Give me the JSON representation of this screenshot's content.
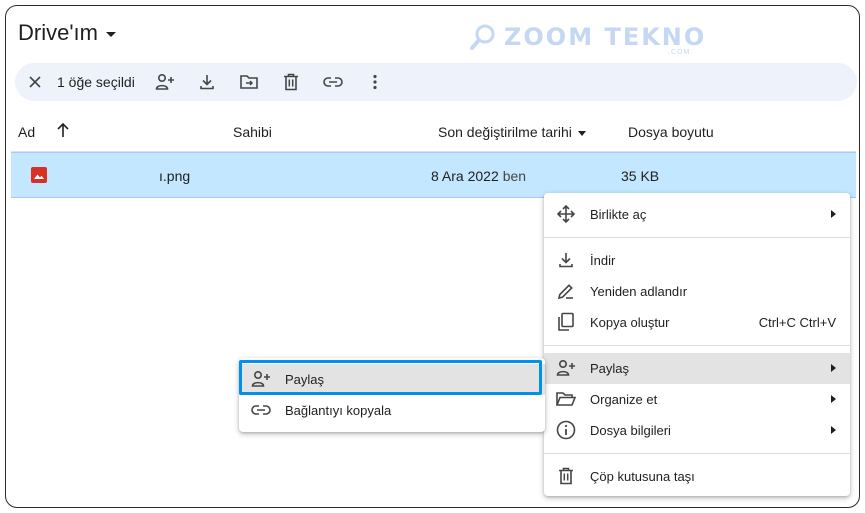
{
  "header": {
    "title": "Drive'ım"
  },
  "watermark": {
    "text": "ZOOM TEKNO",
    "sub": ".COM"
  },
  "selection_bar": {
    "count_label": "1 öğe seçildi"
  },
  "columns": {
    "name": "Ad",
    "owner": "Sahibi",
    "modified": "Son değiştirilme tarihi",
    "size": "Dosya boyutu"
  },
  "file_row": {
    "name": "ı.png",
    "modified": "8 Ara 2022",
    "modified_by": "ben",
    "size": "35 KB"
  },
  "context_menu": {
    "open_with": "Birlikte aç",
    "download": "İndir",
    "rename": "Yeniden adlandır",
    "copy": "Kopya oluştur",
    "copy_shortcut": "Ctrl+C Ctrl+V",
    "share": "Paylaş",
    "organize": "Organize et",
    "file_info": "Dosya bilgileri",
    "trash": "Çöp kutusuna taşı"
  },
  "share_submenu": {
    "share": "Paylaş",
    "copy_link": "Bağlantıyı kopyala"
  },
  "colors": {
    "selected_row": "#c2e7ff",
    "selection_bar": "#edf2fb",
    "focus": "#0091ea",
    "image_icon": "#d93025"
  }
}
